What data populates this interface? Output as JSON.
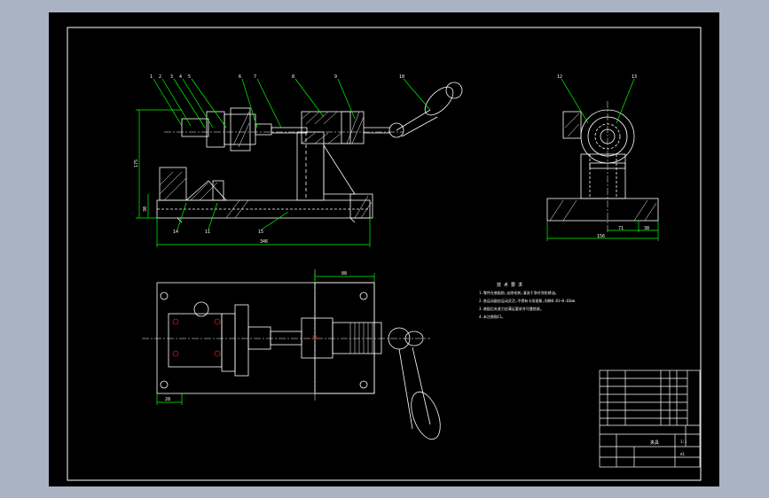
{
  "drawing": {
    "balloons": [
      "1",
      "2",
      "3",
      "4",
      "5",
      "6",
      "7",
      "8",
      "9",
      "10",
      "11",
      "12",
      "13",
      "14",
      "15"
    ],
    "dimensions": {
      "front_height": "175",
      "front_sub_height": "30",
      "front_width": "346",
      "side_width": "156",
      "side_dim_a": "71",
      "side_dim_b": "38",
      "plan_top": "88",
      "plan_bottom": "28"
    },
    "technical_requirements": {
      "title": "技 术 要 求",
      "items": [
        "1.零件在装配前,去除毛刺,清洗干净并涂防锈油。",
        "2.各运动副应运动灵活,不得有卡滞现象,间隙0.01~0.03mm",
        "3.装配后夹紧力应满足要求并可靠锁紧。",
        "4.未注倒角C1。"
      ]
    },
    "title_block": {
      "main": "夹具",
      "scale": "1:1",
      "sheet": "A1"
    }
  },
  "colors": {
    "background": "#a9b3c3",
    "paper": "#000000",
    "line": "#ffffff",
    "leader": "#00ff00",
    "red": "#ff0000"
  }
}
